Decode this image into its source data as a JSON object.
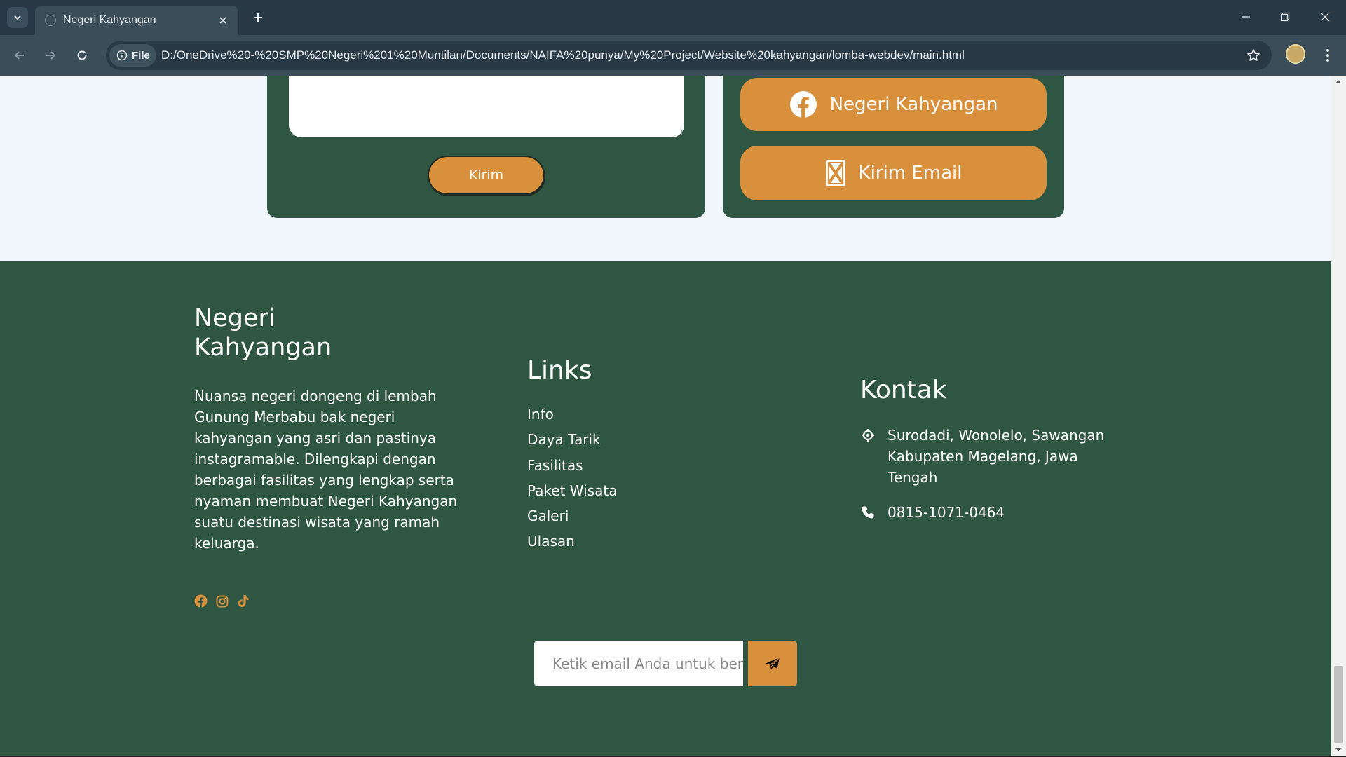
{
  "browser": {
    "tab_title": "Negeri Kahyangan",
    "site_chip": "File",
    "url": "D:/OneDrive%20-%20SMP%20Negeri%201%20Muntilan/Documents/NAIFA%20punya/My%20Project/Website%20kahyangan/lomba-webdev/main.html"
  },
  "contact": {
    "submit_label": "Kirim",
    "facebook_label": "Negeri Kahyangan",
    "email_label": "Kirim Email"
  },
  "footer": {
    "brand_line1": "Negeri",
    "brand_line2": "Kahyangan",
    "description": "Nuansa negeri dongeng di lembah Gunung Merbabu bak negeri kahyangan yang asri dan pastinya instagramable. Dilengkapi dengan berbagai fasilitas yang lengkap serta nyaman membuat Negeri Kahyangan suatu destinasi wisata yang ramah keluarga.",
    "socials": [
      "facebook-icon",
      "instagram-icon",
      "tiktok-icon"
    ],
    "links_heading": "Links",
    "links": [
      "Info",
      "Daya Tarik",
      "Fasilitas",
      "Paket Wisata",
      "Galeri",
      "Ulasan"
    ],
    "kontak_heading": "Kontak",
    "address": "Surodadi, Wonolelo, Sawangan Kabupaten Magelang, Jawa Tengah",
    "phone": "0815-1071-0464",
    "newsletter_placeholder": "Ketik email Anda untuk berlangganan"
  },
  "colors": {
    "green": "#2f5543",
    "orange": "#d9903c",
    "light": "#f0f6fb"
  }
}
